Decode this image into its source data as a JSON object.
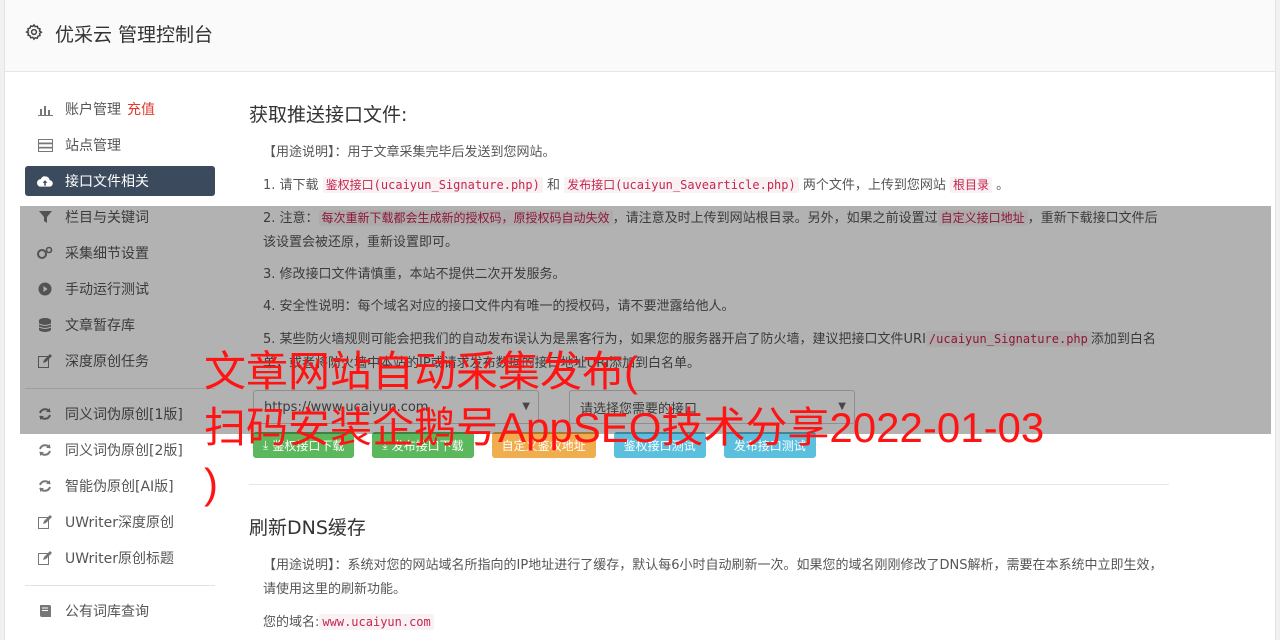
{
  "app": {
    "title": "优采云 管理控制台",
    "icon": "gear-icon"
  },
  "sidebar": {
    "items": [
      {
        "label": "账户管理",
        "extra": "充值",
        "icon": "bar-chart-icon",
        "active": false
      },
      {
        "label": "站点管理",
        "icon": "server-icon",
        "active": false
      },
      {
        "label": "接口文件相关",
        "icon": "cloud-upload-icon",
        "active": true
      },
      {
        "label": "栏目与关键词",
        "icon": "filter-icon",
        "active": false
      },
      {
        "label": "采集细节设置",
        "icon": "cogs-icon",
        "active": false
      },
      {
        "label": "手动运行测试",
        "icon": "play-circle-icon",
        "active": false
      },
      {
        "label": "文章暂存库",
        "icon": "database-icon",
        "active": false
      },
      {
        "label": "深度原创任务",
        "icon": "edit-icon",
        "active": false
      }
    ],
    "items2": [
      {
        "label": "同义词伪原创[1版]",
        "icon": "refresh-icon"
      },
      {
        "label": "同义词伪原创[2版]",
        "icon": "refresh-icon"
      },
      {
        "label": "智能伪原创[AI版]",
        "icon": "refresh-icon"
      },
      {
        "label": "UWriter深度原创",
        "icon": "edit-icon"
      },
      {
        "label": "UWriter原创标题",
        "icon": "edit-icon"
      }
    ],
    "items3": [
      {
        "label": "公有词库查询",
        "icon": "book-icon"
      }
    ]
  },
  "section1": {
    "title": "获取推送接口文件:",
    "usage_label": "【用途说明】",
    "usage_text": "：用于文章采集完毕后发送到您网站。",
    "p1_a": "1. 请下载 ",
    "p1_code1": "鉴权接口(ucaiyun_Signature.php)",
    "p1_b": " 和 ",
    "p1_code2": "发布接口(ucaiyun_Savearticle.php)",
    "p1_c": " 两个文件，上传到您网站 ",
    "p1_code3": "根目录",
    "p1_d": " 。",
    "p2_a": "2. 注意：",
    "p2_code1": "每次重新下载都会生成新的授权码，原授权码自动失效",
    "p2_b": "，请注意及时上传到网站根目录。另外，如果之前设置过",
    "p2_code2": "自定义接口地址",
    "p2_c": "，重新下载接口文件后该设置会被还原，重新设置即可。",
    "p3": "3. 修改接口文件请慎重，本站不提供二次开发服务。",
    "p4": "4. 安全性说明：每个域名对应的接口文件内有唯一的授权码，请不要泄露给他人。",
    "p5_a": "5. 某些防火墙规则可能会把我们的自动发布误认为是黑客行为，如果您的服务器开启了防火墙，建议把接口文件URI",
    "p5_code": "/ucaiyun_Signature.php",
    "p5_b": "添加到白名单，或者将防火墙中本站的IP或请求发布数据的接口地址URI添加到白名单。",
    "select_site": "https://www.ucaiyun.com",
    "select_iface": "请选择您需要的接口",
    "buttons": [
      "鉴权接口下载",
      "发布接口下载",
      "自定义鉴权地址",
      "鉴权接口测试",
      "发布接口测试"
    ]
  },
  "section2": {
    "title": "刷新DNS缓存",
    "usage_label": "【用途说明】",
    "usage_text": "：系统对您的网站域名所指向的IP地址进行了缓存，默认每6小时自动刷新一次。如果您的域名刚刚修改了DNS解析，需要在本系统中立即生效，请使用这里的刷新功能。",
    "domain_label": "您的域名:",
    "domain_value": "www.ucaiyun.com"
  },
  "overlay": {
    "line1": "文章网站自动采集发布(",
    "line2": "扫码安装企鹅号AppSEO技术分享2022-01-03",
    "line3": ")"
  }
}
